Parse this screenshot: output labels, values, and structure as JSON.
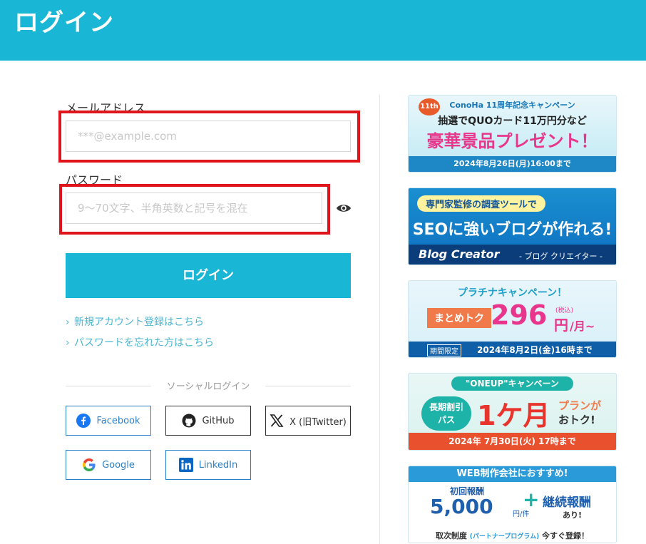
{
  "header": {
    "title": "ログイン"
  },
  "form": {
    "email_label": "メールアドレス",
    "email_placeholder": "***@example.com",
    "password_label": "パスワード",
    "password_placeholder": "9～70文字、半角英数と記号を混在",
    "login_button": "ログイン",
    "signup_link": "新規アカウント登録はこちら",
    "forgot_link": "パスワードを忘れた方はこちら"
  },
  "social": {
    "title": "ソーシャルログイン",
    "facebook": "Facebook",
    "github": "GitHub",
    "x": "X (旧Twitter)",
    "google": "Google",
    "linkedin": "LinkedIn"
  },
  "banners": {
    "b1": {
      "top": "ConoHa 11周年記念キャンペーン",
      "mid": "抽選でQUOカード11万円分など",
      "main": "豪華景品プレゼント！",
      "date": "2024年8月26日(月)16:00まで",
      "badge": "11th"
    },
    "b2": {
      "top": "専門家監修の調査ツールで",
      "main": "SEOに強いブログが作れる!",
      "foot_logo": "Blog Creator",
      "foot_sub": "- ブログ クリエイター -"
    },
    "b3": {
      "title": "プラチナキャンペーン！",
      "tag": "まとめトク",
      "price": "296",
      "yen": "円",
      "tax": "(税込)",
      "per": "/月~",
      "limit": "期間限定",
      "date": "2024年8月2日(金)16時まで"
    },
    "b4": {
      "title": "\"ONEUP\"キャンペーン",
      "tag1": "長期割引",
      "tag2": "パス",
      "main": "1ケ月",
      "plan": "プランが",
      "otoku": "おトク!",
      "date": "2024年 7月30日(火) 17時まで"
    },
    "b5": {
      "title": "WEB制作会社におすすめ!",
      "first": "初回報酬",
      "amount": "5,000",
      "unit": "円/件",
      "plus": "+",
      "cont": "継続報酬",
      "ari": "あり!",
      "foot": "取次制度",
      "foot_sub": "(パートナープログラム)",
      "foot_end": "今すぐ登録！"
    }
  },
  "colors": {
    "brand": "#19b6d6",
    "highlight": "#e0151b",
    "social_blue": "#2a7fc6"
  }
}
